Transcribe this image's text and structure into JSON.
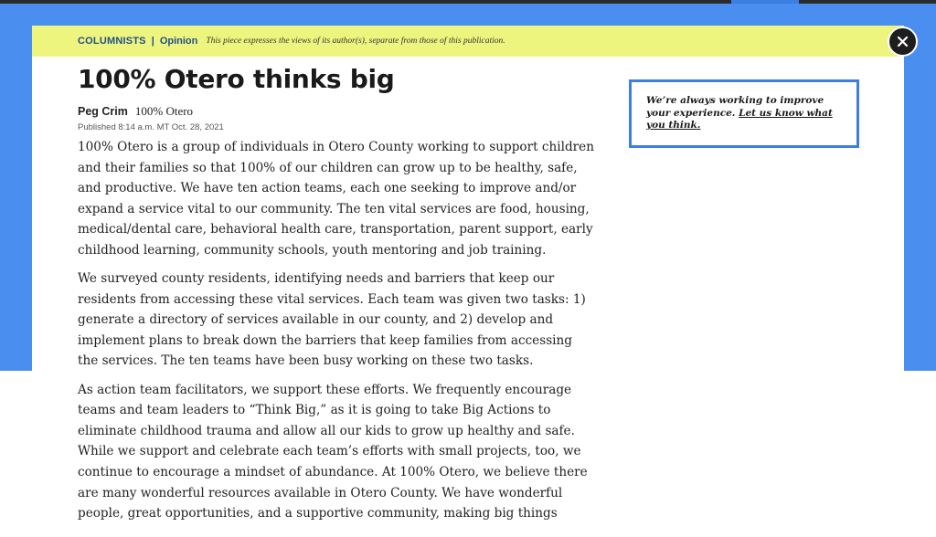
{
  "banner": {
    "section": "COLUMNISTS",
    "separator": "|",
    "type": "Opinion",
    "note": "This piece expresses the views of its author(s), separate from those of this publication."
  },
  "close_button": {
    "label": "×",
    "icon": "close-icon"
  },
  "article": {
    "headline": "100% Otero thinks big",
    "author": "Peg Crim",
    "affiliation": "100% Otero",
    "published": "Published 8:14 a.m. MT Oct. 28, 2021",
    "paragraphs": [
      "100% Otero is a group of individuals in Otero County working to support children and their families so that 100% of our children can grow up to be healthy, safe, and productive.  We have ten action teams, each one seeking to improve and/or expand a service vital to our community. The ten vital services are food, housing, medical/dental care, behavioral health care, transportation, parent support, early childhood learning, community schools, youth mentoring and job training.",
      "We surveyed county residents, identifying needs and barriers that keep our residents from  accessing these vital services. Each team was given two tasks:  1) generate a directory of services available in our county, and 2) develop and implement plans to break down the barriers that keep families from accessing the services.  The ten teams have been busy working on these two tasks.",
      "As action team facilitators, we support these efforts.  We frequently encourage teams and team leaders to “Think Big,” as it is going to take Big Actions to eliminate childhood trauma and allow all our kids to grow up healthy and safe. While we support and celebrate each team’s efforts with small projects, too, we continue to encourage a mindset of abundance. At 100% Otero, we believe there are many wonderful resources available in Otero County. We have wonderful people, great opportunities, and a supportive community, making big things"
    ]
  },
  "feedback": {
    "text": "We’re always working to improve your experience.",
    "link": "Let us know what you think."
  },
  "colors": {
    "background_blue": "#4a8ef0",
    "banner_yellow": "#eef57e",
    "accent_blue": "#3d7fe0",
    "close_dark": "#1e1e1e"
  }
}
